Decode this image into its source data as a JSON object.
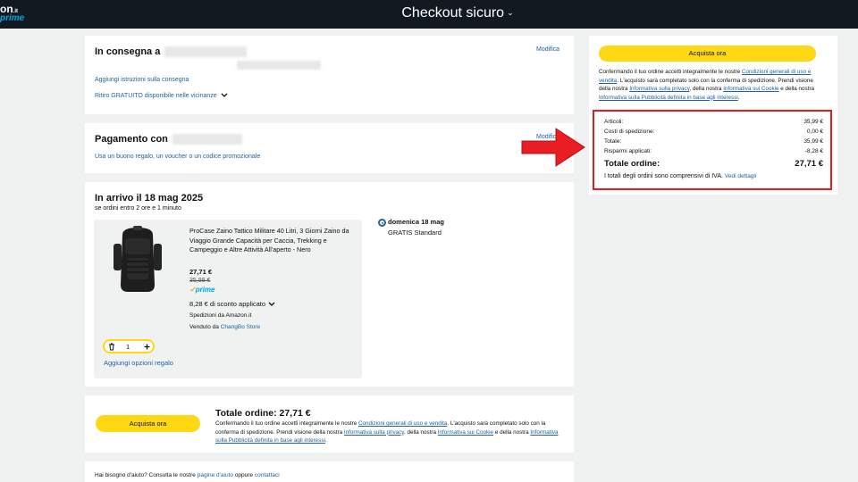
{
  "header": {
    "logo_top": "on",
    "logo_tld": ".it",
    "logo_bottom": "prime",
    "title": "Checkout sicuro",
    "title_chevron": "⌄"
  },
  "shipping": {
    "heading": "In consegna a",
    "edit_label": "Modifica",
    "add_instructions": "Aggiungi istruzioni sulla consegna",
    "free_pickup": "Ritiro GRATUITO disponibile nelle vicinanze"
  },
  "payment": {
    "heading": "Pagamento con",
    "edit_label": "Modifica",
    "promo_link": "Usa un buono regalo, un voucher o un codice promozionale"
  },
  "arrival": {
    "heading": "In arrivo il 18 mag 2025",
    "subtext": "se ordini entro 2 ore e 1 minuto",
    "product": {
      "title": "ProCase Zaino Tattico Militare 40 Litri, 3 Giorni Zaino da Viaggio Grande Capacità per Caccia, Trekking e Campeggio e Altre Attività All'aperto - Nero",
      "price": "27,71 €",
      "old_price": "35,99 €",
      "prime": "prime",
      "discount": "8,28 € di sconto applicato",
      "shipped_by": "Spedizioni da Amazon.it",
      "sold_by_label": "Venduto da",
      "sold_by_store": "ChangBo Store",
      "quantity": "1",
      "gift_link": "Aggiungi opzioni regalo"
    },
    "delivery_option": {
      "day": "domenica 18 mag",
      "type": "GRATIS Standard"
    }
  },
  "bottom": {
    "buy_button": "Acquista ora",
    "total_label": "Totale ordine: 27,71 €",
    "terms_p1": "Confermando il tuo ordine accetti integralmente le nostre",
    "terms_link1": "Condizioni generali di uso e vendita",
    "terms_p2": ". L'acquisto sarà completato solo con la conferma di spedizione. Prendi visione della nostra",
    "terms_link2": "Informativa sulla privacy",
    "terms_p3": ", della nostra",
    "terms_link3": "Informativa sui Cookie",
    "terms_p4": "e della nostra",
    "terms_link4": "Informativa sulla Pubblicità definita in base agli interessi",
    "terms_p5": "."
  },
  "help": {
    "text1": "Hai bisogno d'aiuto? Consulta le nostre",
    "link1": "pagine d'aiuto",
    "text2": "oppure",
    "link2": "contattaci"
  },
  "sidebar": {
    "buy_button": "Acquista ora",
    "terms_p1": "Confermando il tuo ordine accetti integralmente le nostre",
    "terms_link1": "Condizioni generali di uso e vendita",
    "terms_p2": ". L'acquisto sarà completato solo con la conferma di spedizione. Prendi visione della nostra",
    "terms_link2": "Informativa sulla privacy",
    "terms_p3": ", della nostra",
    "terms_link3": "Informativa sui Cookie",
    "terms_p4": "e della nostra",
    "terms_link4": "Informativa sulla Pubblicità definita in base agli interessi",
    "terms_p5": ".",
    "summary": {
      "items_label": "Articoli:",
      "items_value": "35,99 €",
      "shipping_label": "Costi di spedizione:",
      "shipping_value": "0,00 €",
      "total_label": "Totale:",
      "total_value": "35,99 €",
      "savings_label": "Risparmi applicati:",
      "savings_value": "-8,28 €",
      "order_total_label": "Totale ordine:",
      "order_total_value": "27,71 €",
      "vat_note": "I totali degli ordini sono comprensivi di IVA.",
      "details_link": "Vedi dettagli"
    }
  },
  "colors": {
    "header_bg": "#131921",
    "button_yellow": "#ffd814",
    "link_blue": "#2162a1",
    "highlight_red": "#e01e1e",
    "prime_blue": "#00a8e1"
  },
  "icons": {
    "trash": "trash-icon",
    "plus": "plus-icon",
    "chevron": "chevron-down-icon",
    "arrow": "red-arrow-icon"
  }
}
